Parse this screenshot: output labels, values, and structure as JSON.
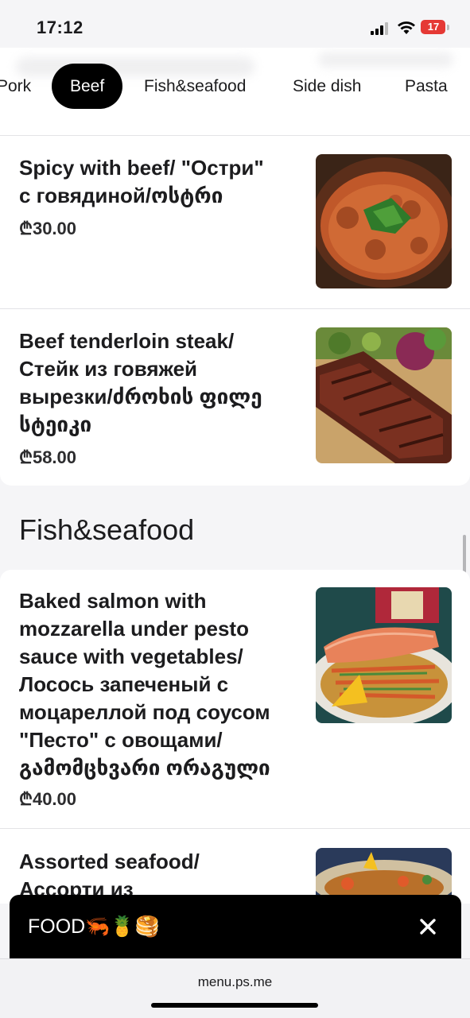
{
  "status": {
    "time": "17:12",
    "battery": "17"
  },
  "categories": {
    "tabs": [
      "Pork",
      "Beef",
      "Fish&seafood",
      "Side dish",
      "Pasta"
    ],
    "active": "Beef"
  },
  "items": [
    {
      "title_lines": [
        "Spicy with beef/ \"Остри\"",
        "с говядиной/ოსტრი"
      ],
      "price": "₾30.00"
    },
    {
      "title_lines": [
        "Beef tenderloin steak/",
        "Стейк из говяжей",
        "вырезки/ძროხის ფილე",
        "სტეიკი"
      ],
      "price": "₾58.00"
    },
    {
      "title_lines": [
        "Baked salmon with",
        "mozzarella under pesto",
        "sauce with vegetables/",
        "Лосось запеченый с",
        "моцареллой под соусом",
        "\"Песто\" с овощами/",
        "გამომცხვარი ორაგული"
      ],
      "price": "₾40.00"
    },
    {
      "title_lines": [
        "Assorted seafood/",
        "Ассорти из"
      ]
    }
  ],
  "section": {
    "title": "Fish&seafood"
  },
  "bottom_bar": {
    "label": "FOOD🦐🍍🥞"
  },
  "browser": {
    "url": "menu.ps.me"
  }
}
